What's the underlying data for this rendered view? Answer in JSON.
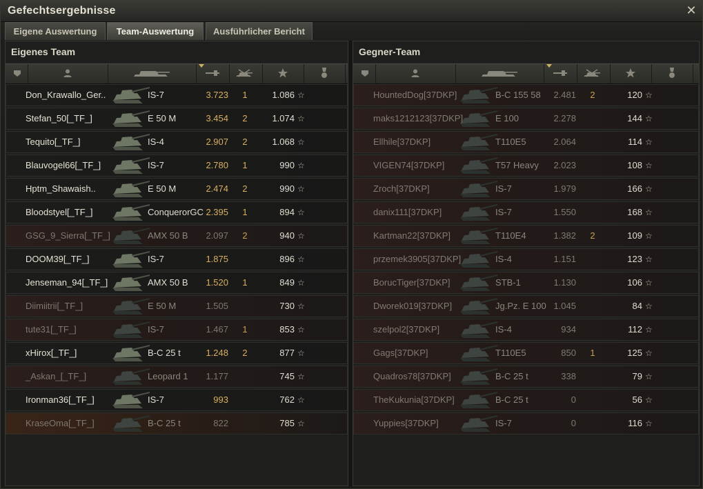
{
  "window": {
    "title": "Gefechtsergebnisse",
    "close_icon": "close-icon"
  },
  "tabs": [
    {
      "label": "Eigene Auswertung",
      "active": false
    },
    {
      "label": "Team-Auswertung",
      "active": true
    },
    {
      "label": "Ausführlicher Bericht",
      "active": false
    }
  ],
  "own_team": {
    "title": "Eigenes Team",
    "columns": [
      "squad-icon",
      "player-icon",
      "tank-icon",
      "xp-icon",
      "kills-icon",
      "star-icon",
      "medal-icon"
    ],
    "rows": [
      {
        "name": "Don_Krawallo_Ger..",
        "tank": "IS-7",
        "xp": "3.723",
        "kills": "1",
        "score": "1.086",
        "state": "alive"
      },
      {
        "name": "Stefan_50[_TF_]",
        "tank": "E 50 M",
        "xp": "3.454",
        "kills": "2",
        "score": "1.074",
        "state": "alive"
      },
      {
        "name": "Tequito[_TF_]",
        "tank": "IS-4",
        "xp": "2.907",
        "kills": "2",
        "score": "1.068",
        "state": "alive"
      },
      {
        "name": "Blauvogel66[_TF_]",
        "tank": "IS-7",
        "xp": "2.780",
        "kills": "1",
        "score": "990",
        "state": "alive"
      },
      {
        "name": "Hptm_Shawaish..",
        "tank": "E 50 M",
        "xp": "2.474",
        "kills": "2",
        "score": "990",
        "state": "alive"
      },
      {
        "name": "Bloodstyel[_TF_]",
        "tank": "ConquerorGC",
        "xp": "2.395",
        "kills": "1",
        "score": "894",
        "state": "alive"
      },
      {
        "name": "GSG_9_Sierra[_TF_]",
        "tank": "AMX 50 B",
        "xp": "2.097",
        "kills": "2",
        "score": "940",
        "state": "dead"
      },
      {
        "name": "DOOM39[_TF_]",
        "tank": "IS-7",
        "xp": "1.875",
        "kills": "",
        "score": "896",
        "state": "alive"
      },
      {
        "name": "Jenseman_94[_TF_]",
        "tank": "AMX 50 B",
        "xp": "1.520",
        "kills": "1",
        "score": "849",
        "state": "alive"
      },
      {
        "name": "Diimiitrii[_TF_]",
        "tank": "E 50 M",
        "xp": "1.505",
        "kills": "",
        "score": "730",
        "state": "dead"
      },
      {
        "name": "tute31[_TF_]",
        "tank": "IS-7",
        "xp": "1.467",
        "kills": "1",
        "score": "853",
        "state": "dead"
      },
      {
        "name": "xHirox[_TF_]",
        "tank": "B-C 25 t",
        "xp": "1.248",
        "kills": "2",
        "score": "877",
        "state": "alive"
      },
      {
        "name": "_Askan_[_TF_]",
        "tank": "Leopard 1",
        "xp": "1.177",
        "kills": "",
        "score": "745",
        "state": "dead"
      },
      {
        "name": "Ironman36[_TF_]",
        "tank": "IS-7",
        "xp": "993",
        "kills": "",
        "score": "762",
        "state": "alive"
      },
      {
        "name": "KraseOma[_TF_]",
        "tank": "B-C 25 t",
        "xp": "822",
        "kills": "",
        "score": "785",
        "state": "orange"
      }
    ]
  },
  "enemy_team": {
    "title": "Gegner-Team",
    "columns": [
      "squad-icon",
      "player-icon",
      "tank-icon",
      "xp-icon",
      "kills-icon",
      "star-icon",
      "medal-icon"
    ],
    "rows": [
      {
        "name": "HountedDog[37DKP]",
        "tank": "B-C 155 58",
        "xp": "2.481",
        "kills": "2",
        "score": "120"
      },
      {
        "name": "maks1212123[37DKP]",
        "tank": "E 100",
        "xp": "2.278",
        "kills": "",
        "score": "144"
      },
      {
        "name": "Ellhile[37DKP]",
        "tank": "T110E5",
        "xp": "2.064",
        "kills": "",
        "score": "114"
      },
      {
        "name": "VIGEN74[37DKP]",
        "tank": "T57 Heavy",
        "xp": "2.023",
        "kills": "",
        "score": "108"
      },
      {
        "name": "Zroch[37DKP]",
        "tank": "IS-7",
        "xp": "1.979",
        "kills": "",
        "score": "166"
      },
      {
        "name": "danix111[37DKP]",
        "tank": "IS-7",
        "xp": "1.550",
        "kills": "",
        "score": "168"
      },
      {
        "name": "Kartman22[37DKP]",
        "tank": "T110E4",
        "xp": "1.382",
        "kills": "2",
        "score": "109"
      },
      {
        "name": "przemek3905[37DKP]",
        "tank": "IS-4",
        "xp": "1.151",
        "kills": "",
        "score": "123"
      },
      {
        "name": "BorucTiger[37DKP]",
        "tank": "STB-1",
        "xp": "1.130",
        "kills": "",
        "score": "106"
      },
      {
        "name": "Dworek019[37DKP]",
        "tank": "Jg.Pz. E 100",
        "xp": "1.045",
        "kills": "",
        "score": "84"
      },
      {
        "name": "szelpol2[37DKP]",
        "tank": "IS-4",
        "xp": "934",
        "kills": "",
        "score": "112"
      },
      {
        "name": "Gags[37DKP]",
        "tank": "T110E5",
        "xp": "850",
        "kills": "1",
        "score": "125"
      },
      {
        "name": "Quadros78[37DKP]",
        "tank": "B-C 25 t",
        "xp": "338",
        "kills": "",
        "score": "79"
      },
      {
        "name": "TheKukunia[37DKP]",
        "tank": "B-C 25 t",
        "xp": "0",
        "kills": "",
        "score": "56"
      },
      {
        "name": "Yuppies[37DKP]",
        "tank": "IS-7",
        "xp": "0",
        "kills": "",
        "score": "116"
      }
    ]
  },
  "colors": {
    "gold": "#d8b060",
    "dead_row": "#2b1e1c",
    "orange_row": "#3a2418"
  },
  "star_glyph": "☆"
}
